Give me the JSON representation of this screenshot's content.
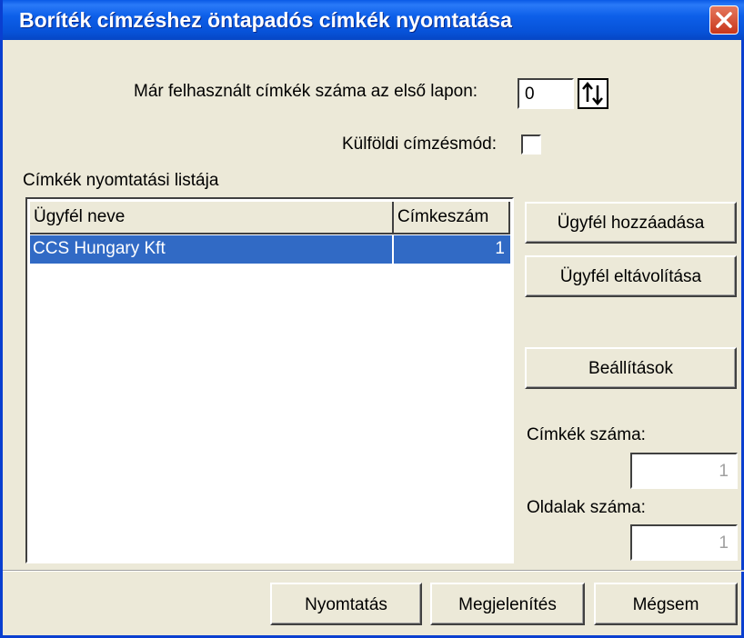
{
  "window": {
    "title": "Boríték címzéshez öntapadós címkék nyomtatása"
  },
  "form": {
    "used_labels_label": "Már felhasznált címkék száma az első lapon:",
    "used_labels_value": "0",
    "foreign_mode_label": "Külföldi címzésmód:",
    "foreign_mode_checked": false,
    "list_label": "Címkék nyomtatási listája"
  },
  "list": {
    "columns": [
      "Ügyfél neve",
      "Címkeszám"
    ],
    "rows": [
      {
        "name": "CCS Hungary Kft",
        "count": "1",
        "selected": true
      }
    ]
  },
  "side": {
    "add_button": "Ügyfél hozzáadása",
    "remove_button": "Ügyfél eltávolítása",
    "settings_button": "Beállítások",
    "label_count_label": "Címkék száma:",
    "label_count_value": "1",
    "page_count_label": "Oldalak száma:",
    "page_count_value": "1"
  },
  "footer": {
    "print_button": "Nyomtatás",
    "preview_button": "Megjelenítés",
    "cancel_button": "Mégsem"
  },
  "colors": {
    "titlebar": "#0752d8",
    "selection": "#316ac5",
    "face": "#ece9d8",
    "close": "#c8361b"
  },
  "icons": {
    "close": "close-x-icon",
    "spin": "up-down-arrows-icon"
  }
}
